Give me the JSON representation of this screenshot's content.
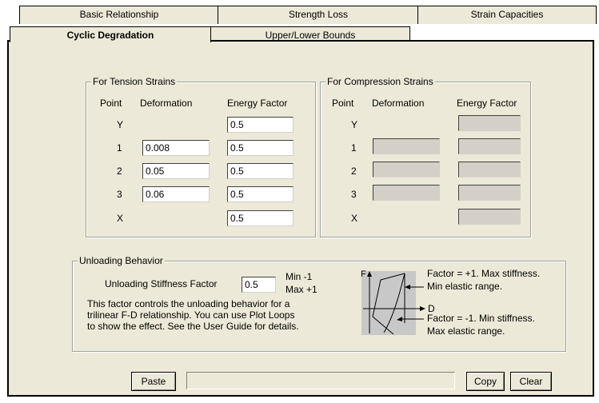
{
  "tabs": {
    "row1": [
      "Basic Relationship",
      "Strength Loss",
      "Strain Capacities"
    ],
    "row2": [
      "Cyclic Degradation",
      "Upper/Lower Bounds"
    ]
  },
  "tension": {
    "title": "For Tension Strains",
    "headers": [
      "Point",
      "Deformation",
      "Energy Factor"
    ],
    "rows": [
      {
        "point": "Y",
        "deformation": null,
        "energy": "0.5"
      },
      {
        "point": "1",
        "deformation": "0.008",
        "energy": "0.5"
      },
      {
        "point": "2",
        "deformation": "0.05",
        "energy": "0.5"
      },
      {
        "point": "3",
        "deformation": "0.06",
        "energy": "0.5"
      },
      {
        "point": "X",
        "deformation": null,
        "energy": "0.5"
      }
    ]
  },
  "compression": {
    "title": "For Compression Strains",
    "headers": [
      "Point",
      "Deformation",
      "Energy Factor"
    ],
    "points": [
      "Y",
      "1",
      "2",
      "3",
      "X"
    ]
  },
  "unloading": {
    "title": "Unloading Behavior",
    "factor_label": "Unloading Stiffness Factor",
    "factor_value": "0.5",
    "min": "Min -1",
    "max": "Max +1",
    "desc1": "This factor controls the unloading behavior for a",
    "desc2": "trilinear F-D relationship. You can use Plot Loops",
    "desc3": "to show the effect. See the User Guide for details.",
    "diagram": {
      "f": "F",
      "d": "D",
      "top1": "Factor = +1. Max stiffness.",
      "top2": "Min elastic range.",
      "bot1": "Factor = -1. Min stiffness.",
      "bot2": "Max elastic range."
    }
  },
  "buttons": {
    "paste": "Paste",
    "copy": "Copy",
    "clear": "Clear"
  }
}
